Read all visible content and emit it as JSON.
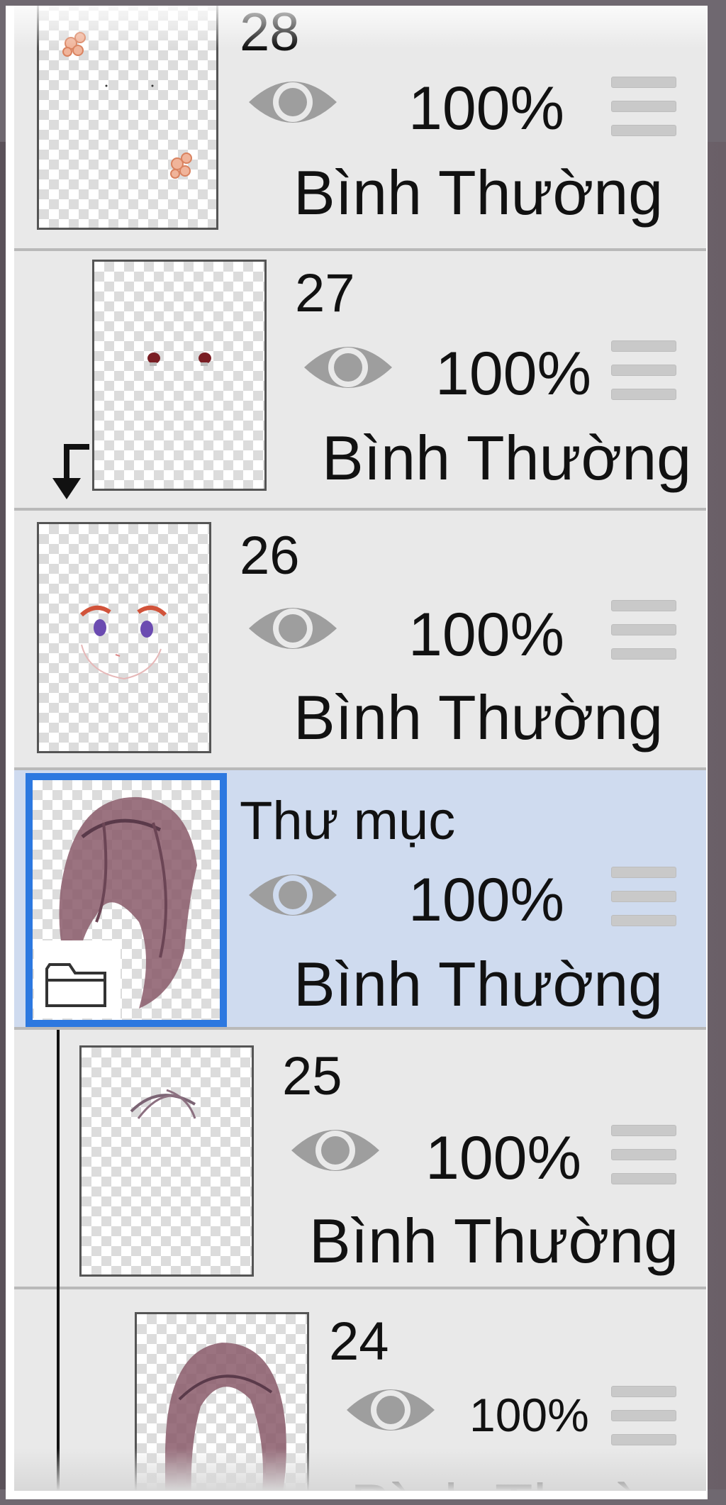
{
  "layers": [
    {
      "id": "layer-28",
      "name": "28",
      "opacity": "100%",
      "blend": "Bình Thường"
    },
    {
      "id": "layer-27",
      "name": "27",
      "opacity": "100%",
      "blend": "Bình Thường"
    },
    {
      "id": "layer-26",
      "name": "26",
      "opacity": "100%",
      "blend": "Bình Thường"
    },
    {
      "id": "folder",
      "name": "Thư mục",
      "opacity": "100%",
      "blend": "Bình Thường"
    },
    {
      "id": "layer-25",
      "name": "25",
      "opacity": "100%",
      "blend": "Bình Thường"
    },
    {
      "id": "layer-24",
      "name": "24",
      "opacity": "100%",
      "blend": "Bình Thườ"
    }
  ],
  "icons": {
    "visibility": "eye-icon",
    "reorder": "drag-handle-icon",
    "folder": "folder-icon",
    "clip": "clip-arrow-icon"
  },
  "colors": {
    "selected_row": "#cfdbef",
    "selected_border": "#2c78e0",
    "row_bg": "#e9e9e9"
  }
}
